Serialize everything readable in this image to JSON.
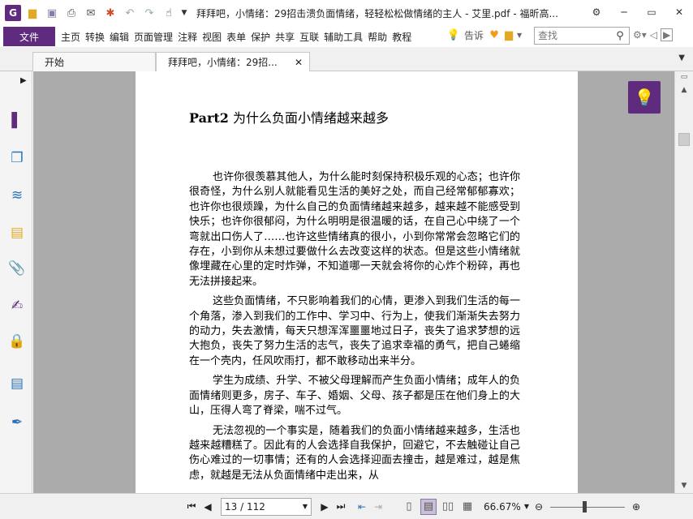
{
  "titlebar": {
    "title": "拜拜吧，小情绪：29招击溃负面情绪，轻轻松松做情绪的主人 - 艾里.pdf - 福昕高...",
    "app_logo": "G",
    "icons": [
      "app-logo",
      "open-folder-icon",
      "save-icon",
      "print-icon",
      "email-icon",
      "new-icon",
      "undo-icon",
      "redo-icon",
      "hand-tool-icon",
      "quick-access-dropdown-icon"
    ],
    "window_controls": [
      "settings-icon",
      "minimize-icon",
      "restore-icon",
      "close-icon"
    ]
  },
  "menubar": {
    "file_label": "文件",
    "items": [
      "主页",
      "转换",
      "编辑",
      "页面管理",
      "注释",
      "视图",
      "表单",
      "保护",
      "共享",
      "互联",
      "辅助工具",
      "帮助",
      "教程"
    ],
    "tell_me_label": "告诉",
    "search_placeholder": "查找"
  },
  "tabs": [
    {
      "label": "开始"
    },
    {
      "label": "拜拜吧，小情绪：29招..."
    }
  ],
  "sidebar": {
    "icons": [
      "page-thumbnail-icon",
      "pages-icon",
      "layers-icon",
      "comments-icon",
      "attachments-icon",
      "signature-icon",
      "security-icon",
      "form-icon",
      "sign-tool-icon"
    ]
  },
  "document": {
    "heading_bold": "Part2",
    "heading_text": " 为什么负面小情绪越来越多",
    "paragraphs": [
      "也许你很羡慕其他人，为什么能时刻保持积极乐观的心态；也许你很奇怪，为什么别人就能看见生活的美好之处，而自己经常郁郁寡欢；也许你也很烦躁，为什么自己的负面情绪越来越多，越来越不能感受到快乐；也许你很郁闷，为什么明明是很温暖的话，在自己心中绕了一个弯就出口伤人了……也许这些情绪真的很小，小到你常常会忽略它们的存在，小到你从未想过要做什么去改变这样的状态。但是这些小情绪就像埋藏在心里的定时炸弹，不知道哪一天就会将你的心炸个粉碎，再也无法拼接起来。",
      "这些负面情绪，不只影响着我们的心情，更渗入到我们生活的每一个角落，渗入到我们的工作中、学习中、行为上，使我们渐渐失去努力的动力，失去激情，每天只想浑浑噩噩地过日子，丧失了追求梦想的远大抱负，丧失了努力生活的志气，丧失了追求幸福的勇气，把自己蜷缩在一个壳内，任风吹雨打，都不敢移动出来半分。",
      "学生为成绩、升学、不被父母理解而产生负面小情绪；成年人的负面情绪则更多，房子、车子、婚姻、父母、孩子都是压在他们身上的大山，压得人弯了脊梁，喘不过气。",
      "无法忽视的一个事实是，随着我们的负面小情绪越来越多，生活也越来越糟糕了。因此有的人会选择自我保护，回避它，不去触碰让自己伤心难过的一切事情；还有的人会选择迎面去撞击，越是难过，越是焦虑，就越是无法从负面情绪中走出来，从"
    ]
  },
  "statusbar": {
    "page_display": "13 / 112",
    "zoom": "66.67%"
  },
  "colors": {
    "accent": "#5e2b7e",
    "doc_background": "#ababab",
    "icon_blue": "#2a73b8"
  }
}
